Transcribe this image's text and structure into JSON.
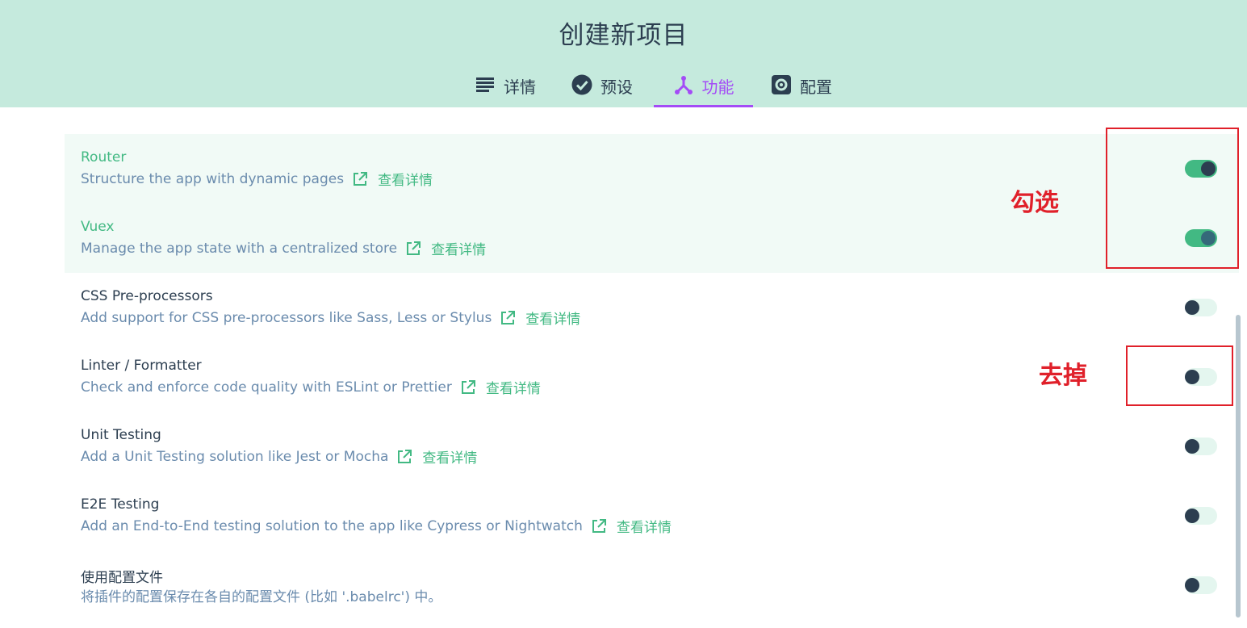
{
  "header": {
    "title": "创建新项目",
    "tabs": [
      {
        "label": "详情",
        "icon": "list-icon"
      },
      {
        "label": "预设",
        "icon": "check-circle-icon"
      },
      {
        "label": "功能",
        "icon": "features-icon",
        "active": true
      },
      {
        "label": "配置",
        "icon": "gear-icon"
      }
    ]
  },
  "features": [
    {
      "name": "Router",
      "description": "Structure the app with dynamic pages",
      "more": "查看详情",
      "enabled": true
    },
    {
      "name": "Vuex",
      "description": "Manage the app state with a centralized store",
      "more": "查看详情",
      "enabled": true
    },
    {
      "name": "CSS Pre-processors",
      "description": "Add support for CSS pre-processors like Sass, Less or Stylus",
      "more": "查看详情",
      "enabled": false
    },
    {
      "name": "Linter / Formatter",
      "description": "Check and enforce code quality with ESLint or Prettier",
      "more": "查看详情",
      "enabled": false
    },
    {
      "name": "Unit Testing",
      "description": "Add a Unit Testing solution like Jest or Mocha",
      "more": "查看详情",
      "enabled": false
    },
    {
      "name": "E2E Testing",
      "description": "Add an End-to-End testing solution to the app like Cypress or Nightwatch",
      "more": "查看详情",
      "enabled": false
    },
    {
      "name": "使用配置文件",
      "description": "将插件的配置保存在各自的配置文件 (比如 '.babelrc') 中。",
      "enabled": false
    }
  ],
  "annotations": {
    "check_label": "勾选",
    "remove_label": "去掉"
  },
  "colors": {
    "header_bg": "#c5eadd",
    "accent": "#42b983",
    "active_tab": "#a44cf6",
    "annotation": "#e0202a"
  }
}
